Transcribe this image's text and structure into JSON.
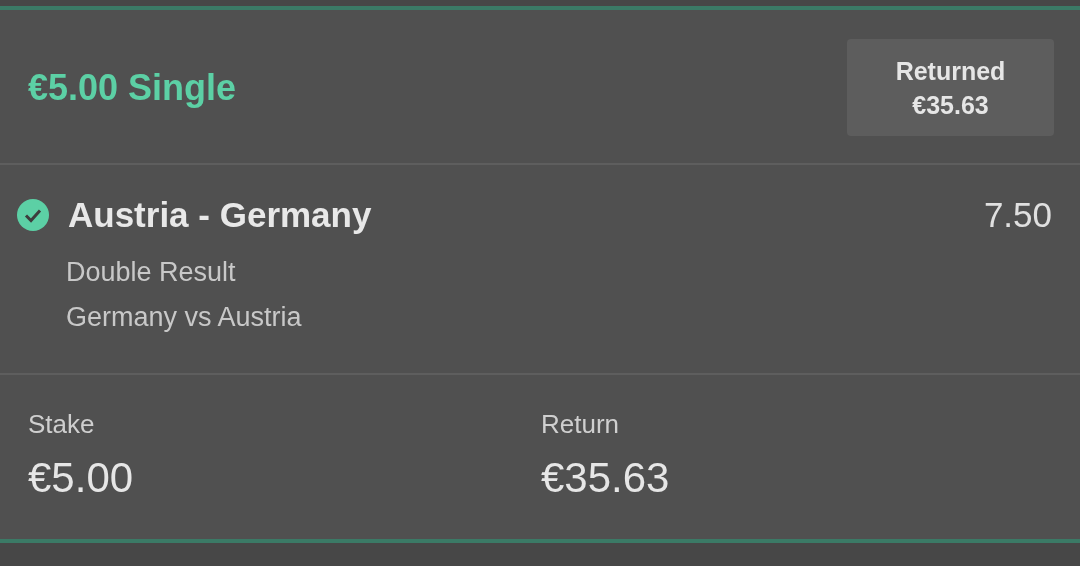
{
  "bet": {
    "title": "€5.00 Single",
    "status_badge": {
      "label": "Returned",
      "amount": "€35.63"
    }
  },
  "selections": [
    {
      "won": true,
      "event": "Austria - Germany",
      "odds": "7.50",
      "market": "Double Result",
      "outcome": "Germany vs Austria"
    }
  ],
  "summary": [
    {
      "label": "Stake",
      "value": "€5.00"
    },
    {
      "label": "Return",
      "value": "€35.63"
    }
  ]
}
